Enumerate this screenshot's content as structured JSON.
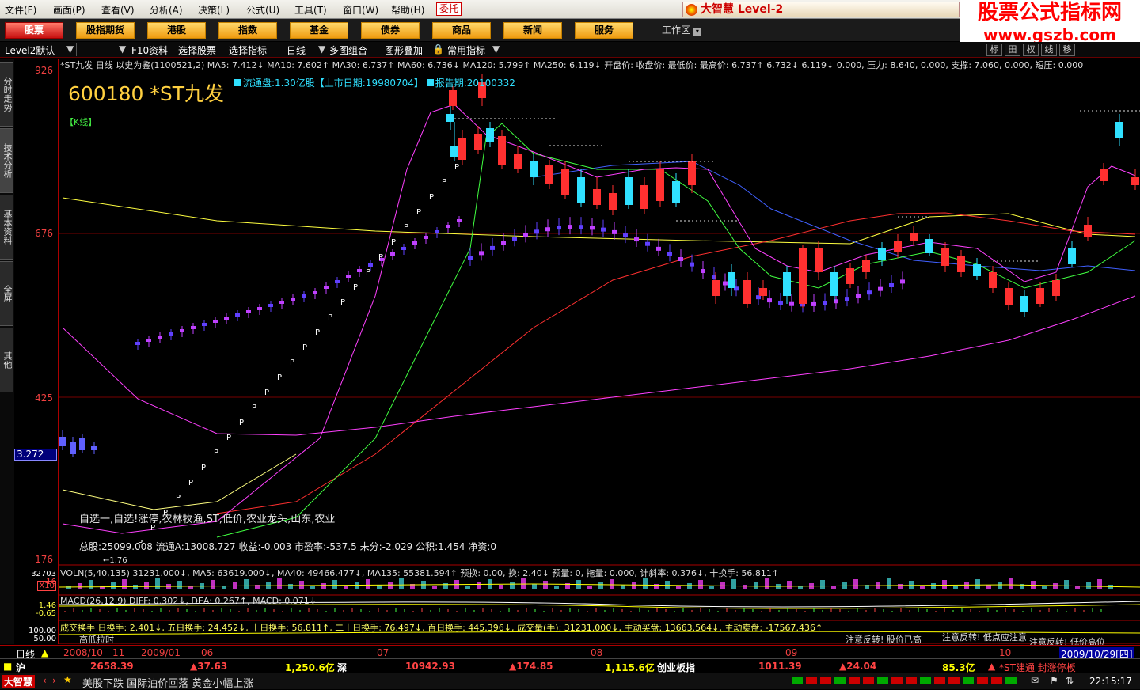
{
  "menu": [
    "文件(F)",
    "画面(P)",
    "查看(V)",
    "分析(A)",
    "决策(L)",
    "公式(U)",
    "工具(T)",
    "窗口(W)",
    "帮助(H)"
  ],
  "entrust": "委托",
  "brand": "大智慧 Level-2",
  "promo": {
    "line1": "股票公式指标网",
    "line2": "www.gszb.com"
  },
  "nav": [
    "股票",
    "股指期货",
    "港股",
    "指数",
    "基金",
    "债券",
    "商品",
    "新闻",
    "服务"
  ],
  "workzone": "工作区",
  "toolbar": {
    "account": "Level2默认",
    "items": [
      "F10资料",
      "选择股票",
      "选择指标",
      "日线",
      "多图组合",
      "图形叠加",
      "常用指标"
    ]
  },
  "right_icons": [
    "标",
    "田",
    "权",
    "线",
    "移"
  ],
  "side_tabs": [
    "分时走势",
    "技术分析",
    "基本资料",
    "全屏",
    "其他"
  ],
  "price_axis": {
    "labels": [
      "926",
      "676",
      "425",
      "176"
    ],
    "current": "3.272"
  },
  "stock": {
    "code": "600180",
    "name": "*ST九发",
    "period": "【K线】"
  },
  "float_info": {
    "float": "流通盘:1.30亿股【上市日期:19980704】",
    "report": "报告期:20100332"
  },
  "ma_line": "*ST九发 日线 以史为鉴(1100521,2) MA5: 7.412↓ MA10: 7.602↑ MA30: 6.737↑ MA60: 6.736↓ MA120: 5.799↑ MA250: 6.119↓ 开盘价: 收盘价: 最低价: 最高价: 6.737↑ 6.732↓ 6.119↓ 0.000, 压力: 8.640, 0.000, 支撑: 7.060, 0.000, 短压: 0.000",
  "tags": "自选一,自选!涨停,农林牧渔,ST,低价,农业龙头,山东,农业",
  "fin": "总股:25099.008 流通A:13008.727 收益:-0.003 市盈率:-537.5 未分:-2.029 公积:1.454 净资:0",
  "low_mark": "←1.76",
  "volume": {
    "label": "VOLN(5,40,135) 31231.000↓, MA5: 63619.000↓, MA40: 49466.477↓, MA135: 55381.594↑ 预换: 0.00, 换: 2.40↓ 预量: 0, 拖量: 0.000, 计斜率: 0.376↓, 十换手: 56.811↑",
    "axis": [
      "32703",
      "16",
      "X10"
    ]
  },
  "macd": {
    "label": "MACD(26,12,9) DIFF: 0.302↓, DEA: 0.267↑, MACD: 0.071↓",
    "axis": [
      "1.46",
      "-0.65"
    ]
  },
  "turnover": {
    "label": "成交换手 日换手: 2.401↓, 五日换手: 24.452↓, 十日换手: 56.811↑, 二十日换手: 76.497↓, 百日换手: 445.396↓, 成交量(手): 31231.000↓, 主动买盘: 13663.564↓, 主动卖盘: -17567.436↑",
    "axis": [
      "100.00",
      "50.00"
    ],
    "notes": [
      "高低拉时",
      "注意反转! 股价已高",
      "注意反转! 低点应注意",
      "注意反转! 低价高位"
    ]
  },
  "dates": [
    "日线",
    "2008/10",
    "11",
    "2009/01",
    "06",
    "07",
    "08",
    "09",
    "10",
    "2009/10/29[四]"
  ],
  "ticker": {
    "sh_label": "沪",
    "sh_index": "2658.39",
    "sh_change": "▲37.63",
    "sh_amount": "1,250.6亿",
    "sz_label": "深",
    "sz_index": "10942.93",
    "sz_change": "▲174.85",
    "sz_amount": "1,115.6亿",
    "cy_label": "创业板指",
    "cy_index": "1011.39",
    "cy_change": "▲24.04",
    "cy_amount": "85.3亿",
    "alert": "*ST建通 封涨停板"
  },
  "status": {
    "logo": "大智慧",
    "news": "美股下跌 国际油价回落 黄金小幅上涨",
    "clock": "22:15:17"
  },
  "colors": {
    "up": "#ff3030",
    "down": "#30e0ff",
    "ma5": "#ffffff",
    "ma10": "#ffff40",
    "ma30": "#ff40ff",
    "ma60": "#40ff40",
    "ma120": "#4060ff",
    "ma250": "#ff3030"
  }
}
